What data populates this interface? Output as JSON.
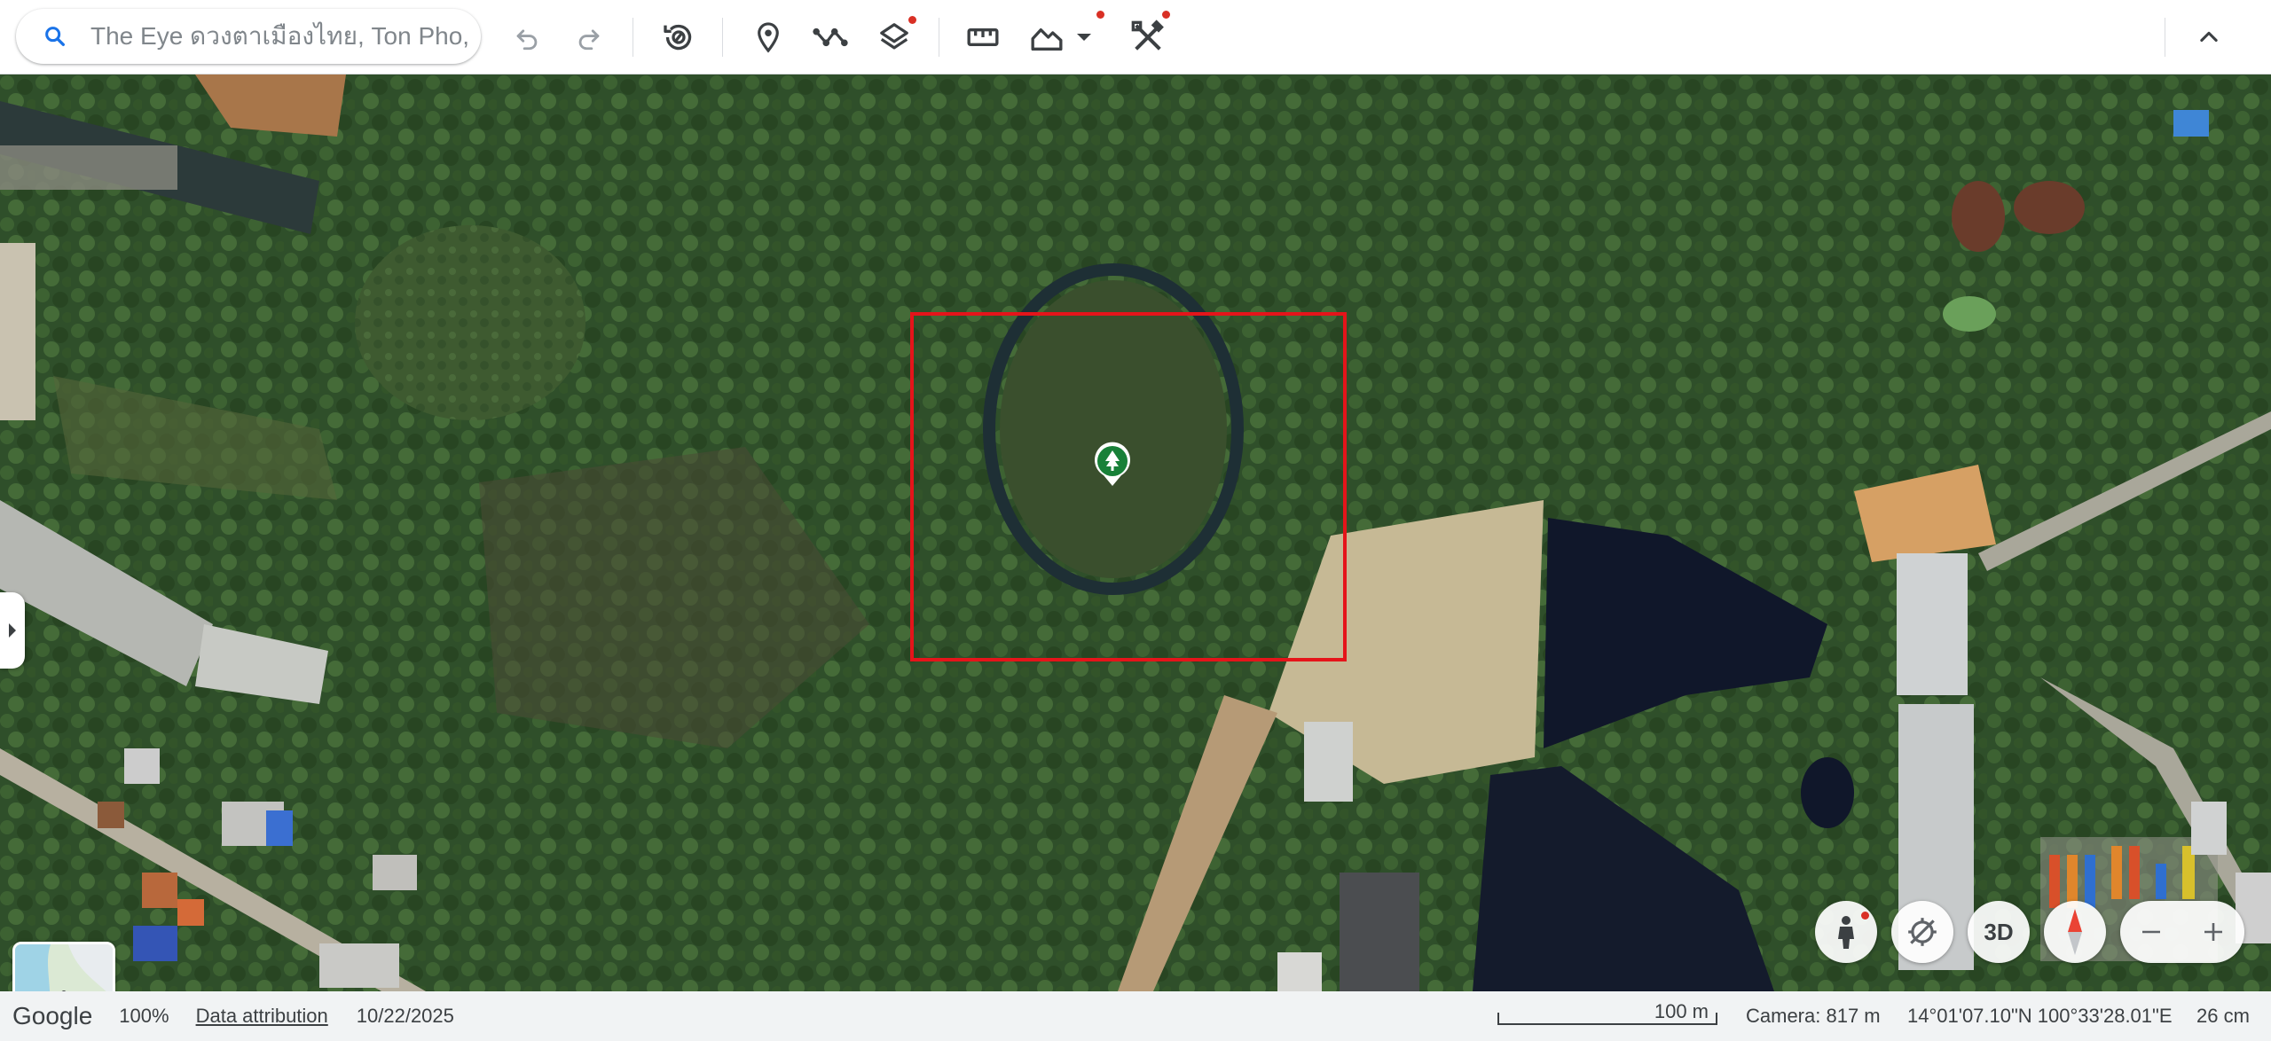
{
  "search": {
    "placeholder": "The Eye ดวงตาเมืองไทย, Ton Pho, ..."
  },
  "toolbar": {
    "icons": [
      "search-icon",
      "undo-icon",
      "redo-icon",
      "historical-imagery-icon",
      "add-placemark-icon",
      "add-path-icon",
      "layers-icon",
      "measure-icon",
      "elevation-profile-icon",
      "dropdown-arrow-icon",
      "tools-icon",
      "collapse-chevron-icon"
    ]
  },
  "map": {
    "controls": {
      "three_d": "3D"
    }
  },
  "status": {
    "logo": "Google",
    "zoom_percent": "100%",
    "data_attribution": "Data attribution",
    "imagery_date": "10/22/2025",
    "scale_label": "100 m",
    "camera": "Camera: 817 m",
    "coordinates": "14°01'07.10\"N 100°33'28.01\"E",
    "elevation": "26 cm"
  },
  "colors": {
    "highlight": "#e5141a",
    "pin": "#188038",
    "accent": "#1a73e8",
    "notification": "#d93025"
  }
}
